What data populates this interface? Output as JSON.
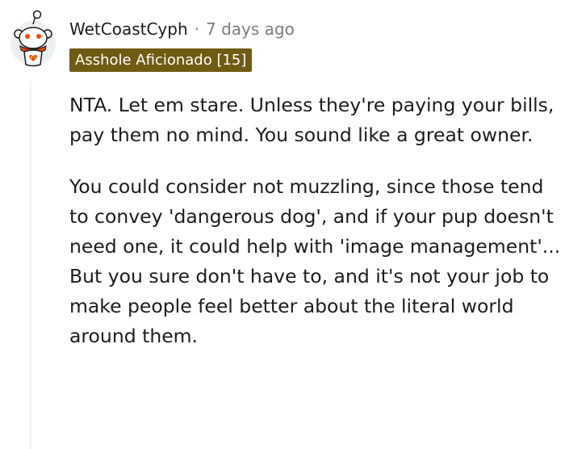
{
  "comment": {
    "username": "WetCoastCyph",
    "separator": "·",
    "timestamp": "7 days ago",
    "flair": "Asshole Aficionado [15]",
    "paragraphs": [
      "NTA. Let em stare. Unless they're paying your bills, pay them no mind. You sound like a great owner.",
      "You could consider not muzzling, since those tend to convey 'dangerous dog', and if your pup doesn't need one, it could help with 'image management'... But you sure don't have to, and it's not your job to make people feel better about the literal world around them."
    ]
  },
  "colors": {
    "flair_background": "#705b12",
    "avatar_accent": "#ff4500",
    "thread_line": "#edeff1"
  },
  "icons": {
    "avatar": "snoo-avatar-icon"
  }
}
